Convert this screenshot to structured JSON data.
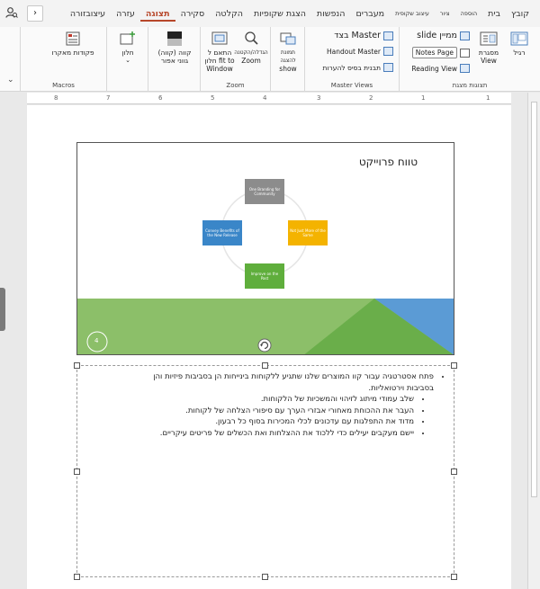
{
  "tabs": [
    {
      "label": "קובץ",
      "active": false,
      "small": false
    },
    {
      "label": "בית",
      "active": false,
      "small": false
    },
    {
      "label": "הוספה",
      "active": false,
      "small": true
    },
    {
      "label": "ציור",
      "active": false,
      "small": true
    },
    {
      "label": "עיצוב שקופית",
      "active": false,
      "small": true
    },
    {
      "label": "מעברים",
      "active": false,
      "small": false
    },
    {
      "label": "הנפשות",
      "active": false,
      "small": false
    },
    {
      "label": "הצגת שקופיות",
      "active": false,
      "small": false
    },
    {
      "label": "הקלטה",
      "active": false,
      "small": false
    },
    {
      "label": "סקירה",
      "active": false,
      "small": false
    },
    {
      "label": "תצוגה",
      "active": true,
      "small": false
    },
    {
      "label": "עזרה",
      "active": false,
      "small": false
    },
    {
      "label": "עיצובזורה",
      "active": false,
      "small": false
    }
  ],
  "tab_scroll_glyph": "›",
  "ribbon": {
    "presentation_views": {
      "label": "תצוגות מצגת",
      "normal": "רגיל",
      "outline_view": "מסגרת\nView",
      "slide_sorter": "slide ממיין",
      "notes_page": "Notes Page",
      "reading_view": "Reading View"
    },
    "master_views": {
      "label": "Master Views",
      "slide_master": "בצד Master",
      "handout_master": "Handout Master",
      "notes_master": "תבנית בסיס להערות"
    },
    "show": {
      "show_label": "show",
      "show_caption": "תמונת להצגה"
    },
    "zoom": {
      "label": "Zoom",
      "zoom_btn": "Zoom",
      "zoom_caption": "הגדלה/הקטנה",
      "fit_window": "התאם ל\nחלון fit to\nWindow"
    },
    "color": {
      "label": "",
      "color_btn": "קווה (קווה)\nגווני אפור"
    },
    "window": {
      "label": "",
      "window_btn": "חלון"
    },
    "macros": {
      "label": "Macros",
      "macros_btn": "פקודות מאקרו"
    }
  },
  "ruler": {
    "numbers": [
      "8",
      "7",
      "6",
      "5",
      "4",
      "3",
      "2",
      "1",
      "1"
    ]
  },
  "slide": {
    "title": "טווח פרוייקט",
    "boxes": {
      "top": "One Branding for Community",
      "right": "Not Just More of the Same",
      "bottom": "Improve on the Past",
      "left": "Convey Benefits of the New Release"
    },
    "page_number": "4"
  },
  "notes": {
    "main_bullet": "פתח אסטרטגיה עבור קוו המוצרים שלנו שתגיע ללקוחות בינייחות הן בסביבות פיזיות והן בסביבות וירטואליות.",
    "sub_bullets": [
      "שלב עמודי מיתוג לזיהוי והמשכיות של הלקוחות.",
      "העבר את ההכוחת מאחורי אבזרי הערך עם סיפורי הצלחה של לקוחות.",
      "מדוד את התפלגות עם עדכונים לכלי המכירות בסוף כל רבעון.",
      "יישם מעקבים יעילים כדי ללכוד את ההצלחות ואת הכשלים של פריטים עיקריים."
    ]
  },
  "colors": {
    "accent": "#b7472a",
    "slide_green": "#8cbf69",
    "slide_dark_green": "#5fae3c",
    "slide_blue": "#5b9bd5"
  }
}
